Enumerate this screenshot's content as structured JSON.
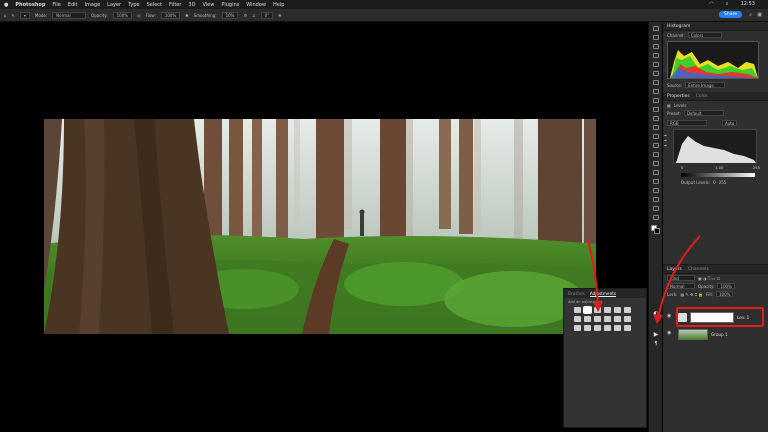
{
  "menubar": {
    "app": "Photoshop",
    "items": [
      "File",
      "Edit",
      "Image",
      "Layer",
      "Type",
      "Select",
      "Filter",
      "3D",
      "View",
      "Plugins",
      "Window",
      "Help"
    ],
    "time": "12:53"
  },
  "options": {
    "mode_label": "Mode:",
    "mode_value": "Normal",
    "opacity_label": "Opacity:",
    "opacity_value": "100%",
    "flow_label": "Flow:",
    "flow_value": "100%",
    "smoothing_label": "Smoothing:",
    "smoothing_value": "10%",
    "angle_value": "0°",
    "share_label": "Share"
  },
  "histogram": {
    "tab": "Histogram",
    "channel_label": "Channel:",
    "channel_value": "Colors",
    "source_label": "Source:",
    "source_value": "Entire Image"
  },
  "properties": {
    "tab": "Properties",
    "tab2": "Color",
    "section": "Levels",
    "preset_label": "Preset:",
    "preset_value": "Default",
    "channel_value": "RGB",
    "auto_label": "Auto",
    "input_black": "0",
    "input_mid": "1.00",
    "input_white": "255",
    "output_label": "Output Levels:",
    "output_black": "0",
    "output_white": "255"
  },
  "adjustments": {
    "tab_brushes": "Brushes",
    "tab_adjustments": "Adjustments",
    "hint": "Add an adjustment"
  },
  "layers": {
    "tab": "Layers",
    "tab2": "Channels",
    "kind_value": "Kind",
    "blend_value": "Normal",
    "opacity_label": "Opacity:",
    "opacity_value": "100%",
    "lock_label": "Lock:",
    "fill_label": "Fill:",
    "fill_value": "100%",
    "items": [
      {
        "name": "Lev..1"
      },
      {
        "name": "Group 1"
      }
    ]
  },
  "colors": {
    "accent": "#2680eb",
    "annotation": "#e41b1b"
  }
}
